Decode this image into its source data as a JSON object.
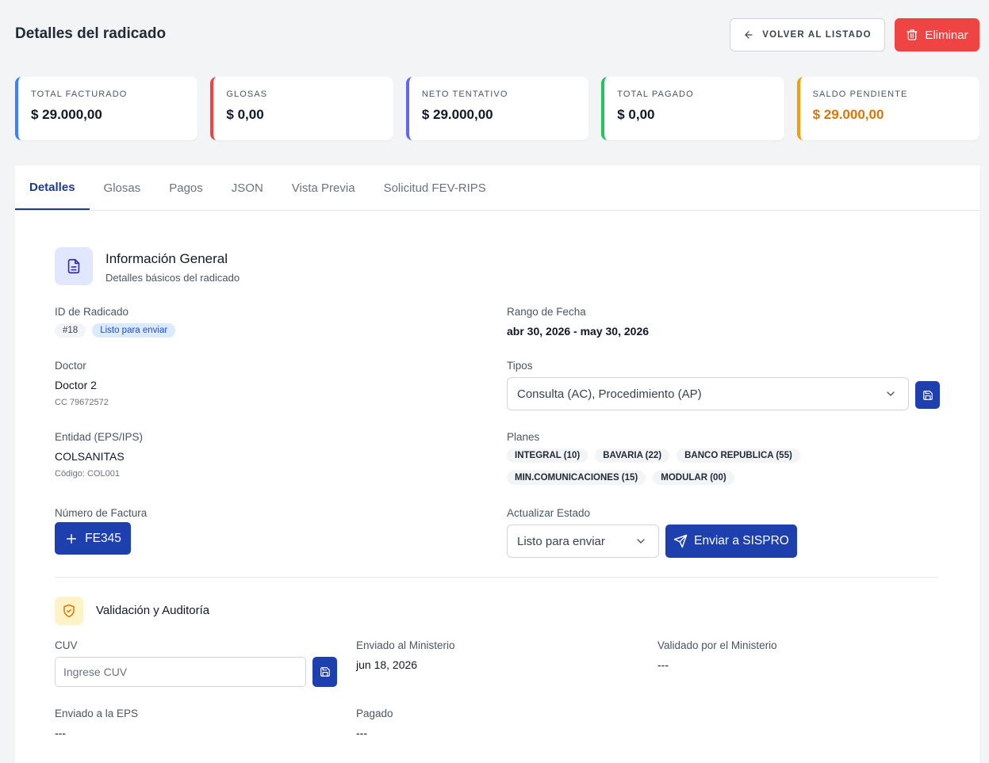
{
  "header": {
    "title": "Detalles del radicado",
    "back_label": "VOLVER AL LISTADO",
    "delete_label": "Eliminar"
  },
  "stats": [
    {
      "label": "TOTAL FACTURADO",
      "value": "$ 29.000,00",
      "accent": "#3b82f6",
      "value_color": "#111827"
    },
    {
      "label": "GLOSAS",
      "value": "$ 0,00",
      "accent": "#ef4444",
      "value_color": "#111827"
    },
    {
      "label": "NETO TENTATIVO",
      "value": "$ 29.000,00",
      "accent": "#6366f1",
      "value_color": "#111827"
    },
    {
      "label": "TOTAL PAGADO",
      "value": "$ 0,00",
      "accent": "#22c55e",
      "value_color": "#111827"
    },
    {
      "label": "SALDO PENDIENTE",
      "value": "$ 29.000,00",
      "accent": "#f59e0b",
      "value_color": "#d97706"
    }
  ],
  "tabs": [
    {
      "label": "Detalles",
      "active": true
    },
    {
      "label": "Glosas"
    },
    {
      "label": "Pagos"
    },
    {
      "label": "JSON"
    },
    {
      "label": "Vista Previa"
    },
    {
      "label": "Solicitud FEV-RIPS"
    }
  ],
  "general": {
    "title": "Información General",
    "subtitle": "Detalles básicos del radicado",
    "id_label": "ID de Radicado",
    "id_value": "#18",
    "status_chip": "Listo para enviar",
    "date_label": "Rango de Fecha",
    "date_value": "abr 30, 2026 - may 30, 2026",
    "doctor_label": "Doctor",
    "doctor_name": "Doctor 2",
    "doctor_doc": "CC 79672572",
    "tipos_label": "Tipos",
    "tipos_value": "Consulta (AC), Procedimiento (AP)",
    "entity_label": "Entidad (EPS/IPS)",
    "entity_name": "COLSANITAS",
    "entity_code": "Código: COL001",
    "planes_label": "Planes",
    "planes": [
      "INTEGRAL (10)",
      "BAVARIA (22)",
      "BANCO REPUBLICA (55)",
      "MIN.COMUNICACIONES (15)",
      "MODULAR (00)"
    ],
    "invoice_label": "Número de Factura",
    "invoice_value": "FE345",
    "status_label": "Actualizar Estado",
    "status_value": "Listo para enviar",
    "send_label": "Enviar a SISPRO"
  },
  "validation": {
    "title": "Validación y Auditoría",
    "cuv_label": "CUV",
    "cuv_placeholder": "Ingrese CUV",
    "sent_ministry_label": "Enviado al Ministerio",
    "sent_ministry_value": "jun 18, 2026",
    "validated_label": "Validado por el Ministerio",
    "validated_value": "---",
    "sent_eps_label": "Enviado a la EPS",
    "sent_eps_value": "---",
    "paid_label": "Pagado",
    "paid_value": "---"
  }
}
